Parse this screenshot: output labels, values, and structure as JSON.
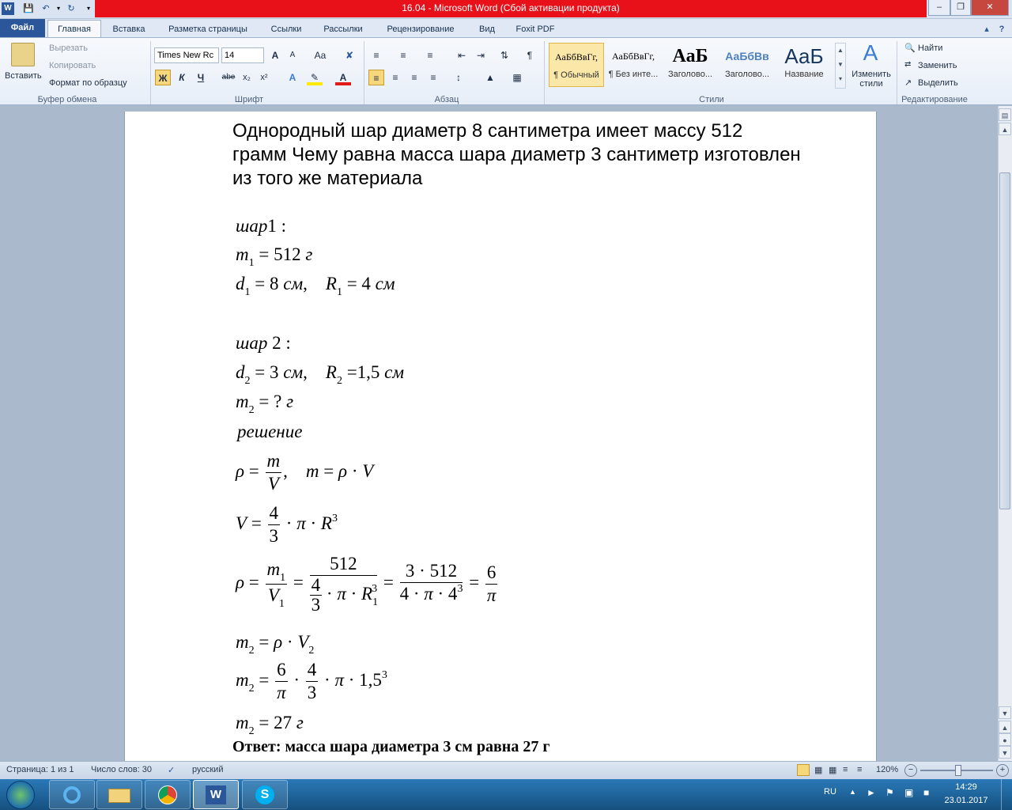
{
  "window": {
    "title": "16.04 - Microsoft Word (Сбой активации продукта)",
    "controls": {
      "minimize": "–",
      "restore": "❐",
      "close": "✕"
    }
  },
  "quick_access": {
    "save_icon": "save-icon",
    "undo_icon": "undo-icon",
    "redo_icon": "redo-icon"
  },
  "tabs": {
    "file": "Файл",
    "items": [
      "Главная",
      "Вставка",
      "Разметка страницы",
      "Ссылки",
      "Рассылки",
      "Рецензирование",
      "Вид",
      "Foxit PDF"
    ]
  },
  "ribbon": {
    "clipboard": {
      "paste": "Вставить",
      "cut": "Вырезать",
      "copy": "Копировать",
      "format_painter": "Формат по образцу",
      "group": "Буфер обмена"
    },
    "font": {
      "name": "Times New Rc",
      "size": "14",
      "bold": "Ж",
      "italic": "К",
      "underline": "Ч",
      "strike": "abe",
      "sub": "x₂",
      "sup": "x²",
      "grow": "A",
      "shrink": "A",
      "case": "Aa",
      "group": "Шрифт"
    },
    "paragraph": {
      "group": "Абзац",
      "pilcrow": "¶"
    },
    "styles": {
      "group": "Стили",
      "items": [
        {
          "preview": "АаБбВвГг,",
          "name": "¶ Обычный"
        },
        {
          "preview": "АаБбВвГг,",
          "name": "¶ Без инте..."
        },
        {
          "preview": "АаБ",
          "name": "Заголово..."
        },
        {
          "preview": "АаБбВв",
          "name": "Заголово..."
        },
        {
          "preview": "АаБ",
          "name": "Название"
        }
      ],
      "change": "Изменить стили"
    },
    "editing": {
      "find": "Найти",
      "replace": "Заменить",
      "select": "Выделить",
      "group": "Редактирование"
    }
  },
  "document": {
    "question": "Однородный шар диаметр 8 сантиметра имеет массу 512 грамм Чему равна масса шара диаметр 3 сантиметр изготовлен из того же материала",
    "ball1_label": "шар",
    "ball1_num": "1",
    "ball2_label": "шар",
    "ball2_num": "2",
    "solution_label": "решение",
    "answer": "Ответ: масса шара диаметра 3 см равна 27 г"
  },
  "status": {
    "page": "Страница: 1 из 1",
    "words": "Число слов: 30",
    "lang": "русский",
    "zoom": "120%"
  },
  "taskbar": {
    "lang": "RU",
    "time": "14:29",
    "date": "23.01.2017"
  }
}
